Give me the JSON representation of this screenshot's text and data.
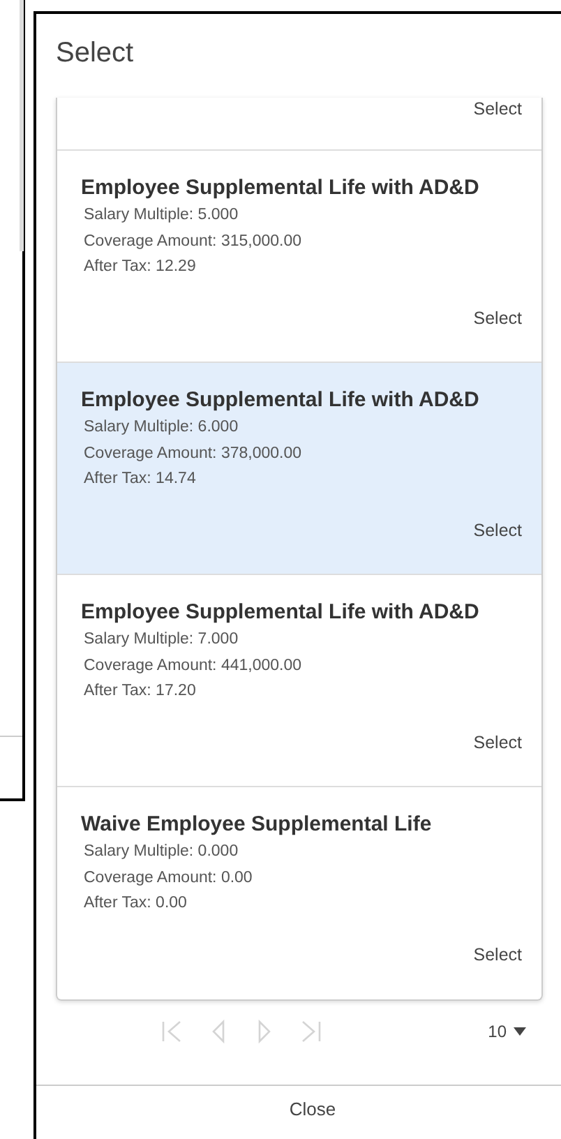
{
  "dialog": {
    "title": "Select",
    "options": [
      {
        "select_label": "Select",
        "selected": false
      },
      {
        "title": "Employee Supplemental Life with AD&D",
        "details": [
          "Salary Multiple: 5.000",
          "Coverage Amount: 315,000.00",
          "After Tax: 12.29"
        ],
        "select_label": "Select",
        "selected": false
      },
      {
        "title": "Employee Supplemental Life with AD&D",
        "details": [
          "Salary Multiple: 6.000",
          "Coverage Amount: 378,000.00",
          "After Tax: 14.74"
        ],
        "select_label": "Select",
        "selected": true
      },
      {
        "title": "Employee Supplemental Life with AD&D",
        "details": [
          "Salary Multiple: 7.000",
          "Coverage Amount: 441,000.00",
          "After Tax: 17.20"
        ],
        "select_label": "Select",
        "selected": false
      },
      {
        "title": "Waive Employee Supplemental Life",
        "details": [
          "Salary Multiple: 0.000",
          "Coverage Amount: 0.00",
          "After Tax: 0.00"
        ],
        "select_label": "Select",
        "selected": false
      }
    ],
    "pager": {
      "first_disabled": true,
      "prev_disabled": true,
      "next_disabled": true,
      "last_disabled": true,
      "page_size": "10"
    },
    "close_label": "Close"
  }
}
